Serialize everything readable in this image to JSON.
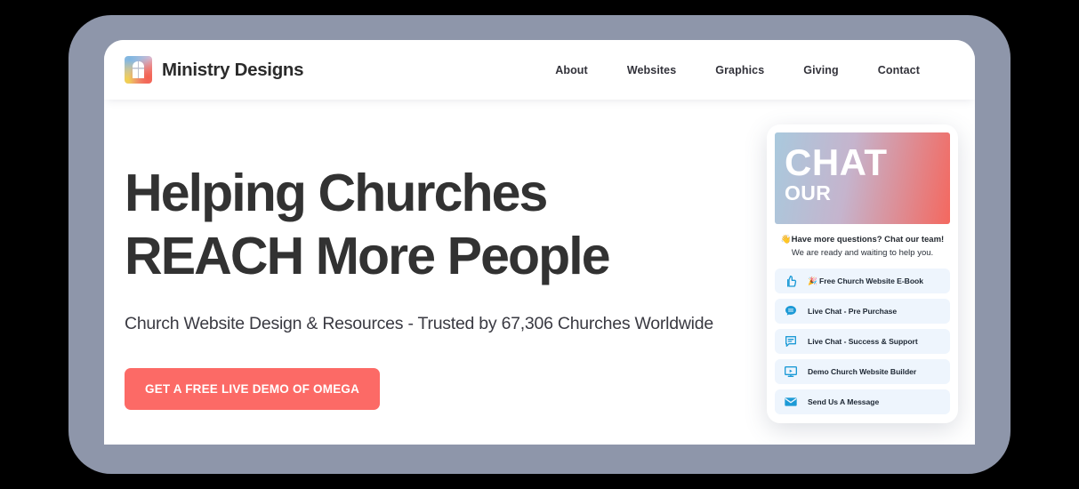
{
  "brand": {
    "name": "Ministry Designs",
    "logo_icon": "church-window-logo-icon"
  },
  "nav": {
    "items": [
      {
        "label": "About"
      },
      {
        "label": "Websites"
      },
      {
        "label": "Graphics"
      },
      {
        "label": "Giving"
      },
      {
        "label": "Contact"
      }
    ]
  },
  "hero": {
    "title_line1": "Helping Churches",
    "title_line2": "REACH More People",
    "subtitle": "Church Website Design & Resources - Trusted by 67,306 Churches Worldwide",
    "cta_label": "GET A FREE LIVE DEMO OF OMEGA"
  },
  "chat_widget": {
    "banner_line1": "CHAT",
    "banner_line2": "OUR",
    "greeting_wave": "👋",
    "greeting": "Have more questions? Chat our team!",
    "greeting_sub": "We are ready and waiting to help you.",
    "options": [
      {
        "icon": "thumbs-up-icon",
        "emoji": "🎉",
        "label": "Free Church Website E-Book"
      },
      {
        "icon": "chat-bubble-filled-icon",
        "emoji": "",
        "label": "Live Chat - Pre Purchase"
      },
      {
        "icon": "chat-bubble-lines-icon",
        "emoji": "",
        "label": "Live Chat - Success & Support"
      },
      {
        "icon": "monitor-play-icon",
        "emoji": "",
        "label": "Demo Church Website Builder"
      },
      {
        "icon": "envelope-icon",
        "emoji": "",
        "label": "Send Us A Message"
      }
    ]
  },
  "colors": {
    "bezel": "#8e96aa",
    "cta": "#fc6a66",
    "chat_icon": "#1c9ad6",
    "chat_option_bg": "#eef5fd",
    "heading": "#323232"
  }
}
